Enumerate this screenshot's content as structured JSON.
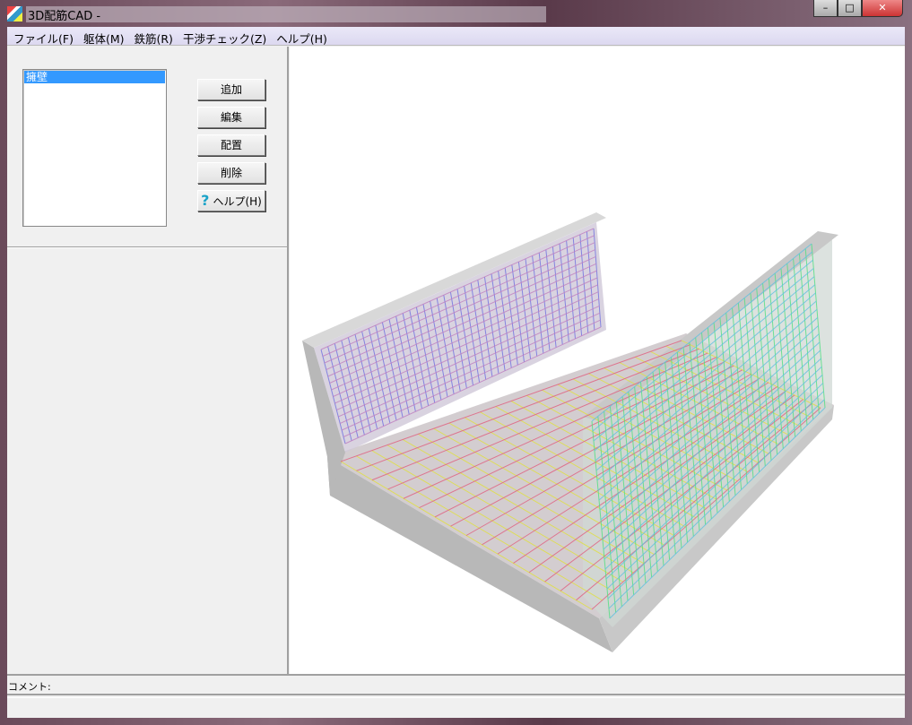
{
  "window": {
    "title": "3D配筋CAD -",
    "minimize": "–",
    "maximize": "□",
    "close": "✕"
  },
  "menu": [
    "ファイル(F)",
    "躯体(M)",
    "鉄筋(R)",
    "干渉チェック(Z)",
    "ヘルプ(H)"
  ],
  "list": {
    "items": [
      "擁壁"
    ]
  },
  "buttons": {
    "add": "追加",
    "edit": "編集",
    "place": "配置",
    "delete": "削除",
    "help": "ヘルプ(H)"
  },
  "comment_label": "コメント:",
  "colors": {
    "selection": "#3399ff",
    "rebar_left": "#7070e0",
    "rebar_right": "#50e080",
    "rebar_base_a": "#e0e040",
    "rebar_base_b": "#e06080"
  }
}
